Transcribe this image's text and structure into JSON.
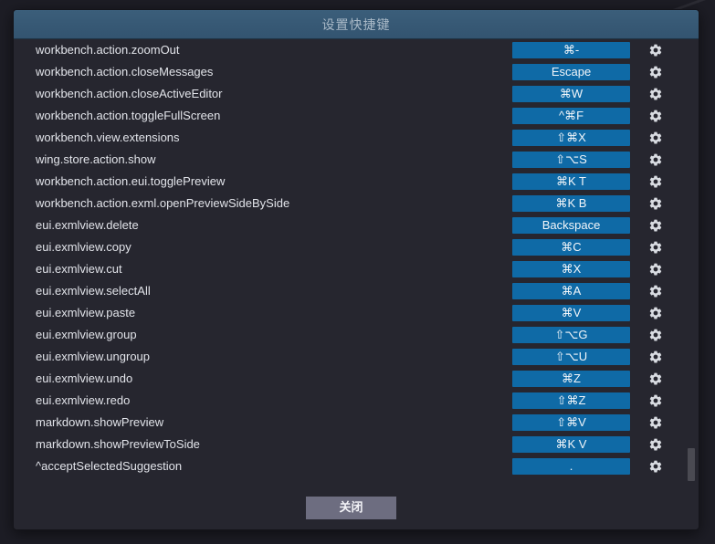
{
  "dialog": {
    "title": "设置快捷键",
    "close_label": "关闭",
    "accent_color": "#0f6aa6",
    "titlebar_color": "#3b5e7a"
  },
  "bindings": [
    {
      "command": "workbench.action.zoomOut",
      "key": "⌘-",
      "icon": "gear-icon"
    },
    {
      "command": "workbench.action.closeMessages",
      "key": "Escape",
      "icon": "gear-icon"
    },
    {
      "command": "workbench.action.closeActiveEditor",
      "key": "⌘W",
      "icon": "gear-icon"
    },
    {
      "command": "workbench.action.toggleFullScreen",
      "key": "^⌘F",
      "icon": "gear-icon"
    },
    {
      "command": "workbench.view.extensions",
      "key": "⇧⌘X",
      "icon": "gear-icon"
    },
    {
      "command": "wing.store.action.show",
      "key": "⇧⌥S",
      "icon": "gear-icon"
    },
    {
      "command": "workbench.action.eui.togglePreview",
      "key": "⌘K T",
      "icon": "gear-icon"
    },
    {
      "command": "workbench.action.exml.openPreviewSideBySide",
      "key": "⌘K B",
      "icon": "gear-icon"
    },
    {
      "command": "eui.exmlview.delete",
      "key": "Backspace",
      "icon": "gear-icon"
    },
    {
      "command": "eui.exmlview.copy",
      "key": "⌘C",
      "icon": "gear-icon"
    },
    {
      "command": "eui.exmlview.cut",
      "key": "⌘X",
      "icon": "gear-icon"
    },
    {
      "command": "eui.exmlview.selectAll",
      "key": "⌘A",
      "icon": "gear-icon"
    },
    {
      "command": "eui.exmlview.paste",
      "key": "⌘V",
      "icon": "gear-icon"
    },
    {
      "command": "eui.exmlview.group",
      "key": "⇧⌥G",
      "icon": "gear-icon"
    },
    {
      "command": "eui.exmlview.ungroup",
      "key": "⇧⌥U",
      "icon": "gear-icon"
    },
    {
      "command": "eui.exmlview.undo",
      "key": "⌘Z",
      "icon": "gear-icon"
    },
    {
      "command": "eui.exmlview.redo",
      "key": "⇧⌘Z",
      "icon": "gear-icon"
    },
    {
      "command": "markdown.showPreview",
      "key": "⇧⌘V",
      "icon": "gear-icon"
    },
    {
      "command": "markdown.showPreviewToSide",
      "key": "⌘K V",
      "icon": "gear-icon"
    },
    {
      "command": "^acceptSelectedSuggestion",
      "key": ".",
      "icon": "gear-icon"
    }
  ]
}
